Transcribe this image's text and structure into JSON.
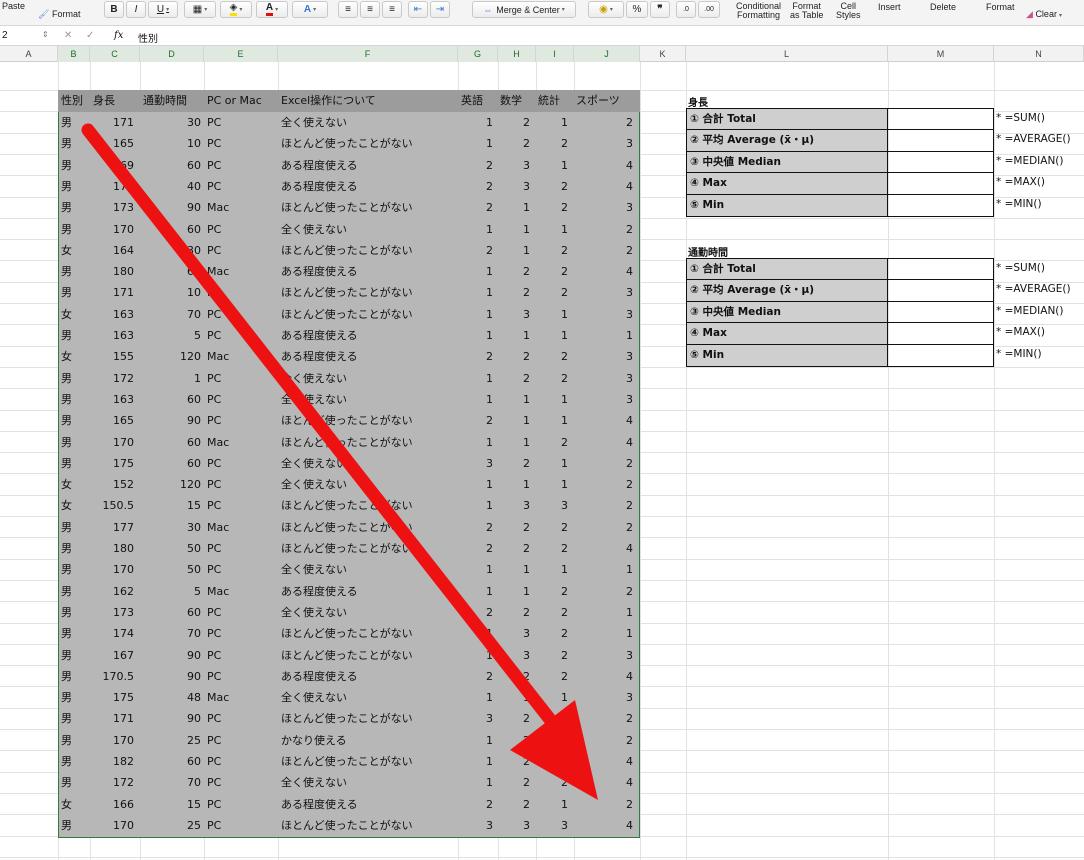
{
  "ribbon": {
    "paste": "Paste",
    "format_painter": "Format",
    "bold": "B",
    "italic": "I",
    "underline": "U",
    "merge_center": "Merge & Center",
    "percent": "%",
    "comma": "❞",
    "inc_dec_1": ".0",
    "inc_dec_2": ".00",
    "conditional_1": "Conditional",
    "conditional_2": "Formatting",
    "format_table_1": "Format",
    "format_table_2": "as Table",
    "cell_styles_1": "Cell",
    "cell_styles_2": "Styles",
    "insert": "Insert",
    "delete": "Delete",
    "format": "Format",
    "clear": "Clear"
  },
  "formula_bar": {
    "name_box": "2",
    "fx": "fx",
    "content": "性別"
  },
  "columns": [
    "A",
    "B",
    "C",
    "D",
    "E",
    "F",
    "G",
    "H",
    "I",
    "J",
    "K",
    "L",
    "M",
    "N"
  ],
  "table": {
    "headers": [
      "性別",
      "身長",
      "通勤時間",
      "PC or Mac",
      "Excel操作について",
      "英語",
      "数学",
      "統計",
      "スポーツ"
    ],
    "rows": [
      [
        "男",
        "171",
        "30",
        "PC",
        "全く使えない",
        "1",
        "2",
        "1",
        "2"
      ],
      [
        "男",
        "165",
        "10",
        "PC",
        "ほとんど使ったことがない",
        "1",
        "2",
        "2",
        "3"
      ],
      [
        "男",
        "169",
        "60",
        "PC",
        "ある程度使える",
        "2",
        "3",
        "1",
        "4"
      ],
      [
        "男",
        "170",
        "40",
        "PC",
        "ある程度使える",
        "2",
        "3",
        "2",
        "4"
      ],
      [
        "男",
        "173",
        "90",
        "Mac",
        "ほとんど使ったことがない",
        "2",
        "1",
        "2",
        "3"
      ],
      [
        "男",
        "170",
        "60",
        "PC",
        "全く使えない",
        "1",
        "1",
        "1",
        "2"
      ],
      [
        "女",
        "164",
        "30",
        "PC",
        "ほとんど使ったことがない",
        "2",
        "1",
        "2",
        "2"
      ],
      [
        "男",
        "180",
        "60",
        "Mac",
        "ある程度使える",
        "1",
        "2",
        "2",
        "4"
      ],
      [
        "男",
        "171",
        "10",
        "PC",
        "ほとんど使ったことがない",
        "1",
        "2",
        "2",
        "3"
      ],
      [
        "女",
        "163",
        "70",
        "PC",
        "ほとんど使ったことがない",
        "1",
        "3",
        "1",
        "3"
      ],
      [
        "男",
        "163",
        "5",
        "PC",
        "ある程度使える",
        "1",
        "1",
        "1",
        "1"
      ],
      [
        "女",
        "155",
        "120",
        "Mac",
        "ある程度使える",
        "2",
        "2",
        "2",
        "3"
      ],
      [
        "男",
        "172",
        "1",
        "PC",
        "全く使えない",
        "1",
        "2",
        "2",
        "3"
      ],
      [
        "男",
        "163",
        "60",
        "PC",
        "全く使えない",
        "1",
        "1",
        "1",
        "3"
      ],
      [
        "男",
        "165",
        "90",
        "PC",
        "ほとんど使ったことがない",
        "2",
        "1",
        "1",
        "4"
      ],
      [
        "男",
        "170",
        "60",
        "Mac",
        "ほとんど使ったことがない",
        "1",
        "1",
        "2",
        "4"
      ],
      [
        "男",
        "175",
        "60",
        "PC",
        "全く使えない",
        "3",
        "2",
        "1",
        "2"
      ],
      [
        "女",
        "152",
        "120",
        "PC",
        "全く使えない",
        "1",
        "1",
        "1",
        "2"
      ],
      [
        "女",
        "150.5",
        "15",
        "PC",
        "ほとんど使ったことがない",
        "1",
        "3",
        "3",
        "2"
      ],
      [
        "男",
        "177",
        "30",
        "Mac",
        "ほとんど使ったことがない",
        "2",
        "2",
        "2",
        "2"
      ],
      [
        "男",
        "180",
        "50",
        "PC",
        "ほとんど使ったことがない",
        "2",
        "2",
        "2",
        "4"
      ],
      [
        "男",
        "170",
        "50",
        "PC",
        "全く使えない",
        "1",
        "1",
        "1",
        "1"
      ],
      [
        "男",
        "162",
        "5",
        "Mac",
        "ある程度使える",
        "1",
        "1",
        "2",
        "2"
      ],
      [
        "男",
        "173",
        "60",
        "PC",
        "全く使えない",
        "2",
        "2",
        "2",
        "1"
      ],
      [
        "男",
        "174",
        "70",
        "PC",
        "ほとんど使ったことがない",
        "1",
        "3",
        "2",
        "1"
      ],
      [
        "男",
        "167",
        "90",
        "PC",
        "ほとんど使ったことがない",
        "1",
        "3",
        "2",
        "3"
      ],
      [
        "男",
        "170.5",
        "90",
        "PC",
        "ある程度使える",
        "2",
        "2",
        "2",
        "4"
      ],
      [
        "男",
        "175",
        "48",
        "Mac",
        "全く使えない",
        "1",
        "1",
        "1",
        "3"
      ],
      [
        "男",
        "171",
        "90",
        "PC",
        "ほとんど使ったことがない",
        "3",
        "2",
        "2",
        "2"
      ],
      [
        "男",
        "170",
        "25",
        "PC",
        "かなり使える",
        "1",
        "2",
        "2",
        "2"
      ],
      [
        "男",
        "182",
        "60",
        "PC",
        "ほとんど使ったことがない",
        "1",
        "2",
        "2",
        "4"
      ],
      [
        "男",
        "172",
        "70",
        "PC",
        "全く使えない",
        "1",
        "2",
        "2",
        "4"
      ],
      [
        "女",
        "166",
        "15",
        "PC",
        "ある程度使える",
        "2",
        "2",
        "1",
        "2"
      ],
      [
        "男",
        "170",
        "25",
        "PC",
        "ほとんど使ったことがない",
        "3",
        "3",
        "3",
        "4"
      ]
    ]
  },
  "stats": [
    {
      "title": "身長",
      "rows": [
        {
          "label": "① 合計 Total",
          "formula": "* =SUM()"
        },
        {
          "label": "② 平均 Average (x̄・μ)",
          "formula": "* =AVERAGE()"
        },
        {
          "label": "③ 中央値 Median",
          "formula": "* =MEDIAN()"
        },
        {
          "label": "④ Max",
          "formula": "* =MAX()"
        },
        {
          "label": "⑤ Min",
          "formula": "* =MIN()"
        }
      ]
    },
    {
      "title": "通勤時間",
      "rows": [
        {
          "label": "① 合計 Total",
          "formula": "* =SUM()"
        },
        {
          "label": "② 平均 Average (x̄・μ)",
          "formula": "* =AVERAGE()"
        },
        {
          "label": "③ 中央値 Median",
          "formula": "* =MEDIAN()"
        },
        {
          "label": "④ Max",
          "formula": "* =MAX()"
        },
        {
          "label": "⑤ Min",
          "formula": "* =MIN()"
        }
      ]
    }
  ],
  "colors": {
    "selection_fill": "#b7b7b7",
    "header_fill": "#9c9c9c",
    "selection_border": "#2f7d3d",
    "arrow": "#ee1111",
    "stat_label_fill": "#cfcfcf"
  },
  "icons": [
    "format-painter-icon",
    "borders-icon",
    "fill-color-icon",
    "font-color-icon",
    "merge-icon",
    "currency-icon",
    "eraser-icon",
    "arrow-annotation"
  ]
}
